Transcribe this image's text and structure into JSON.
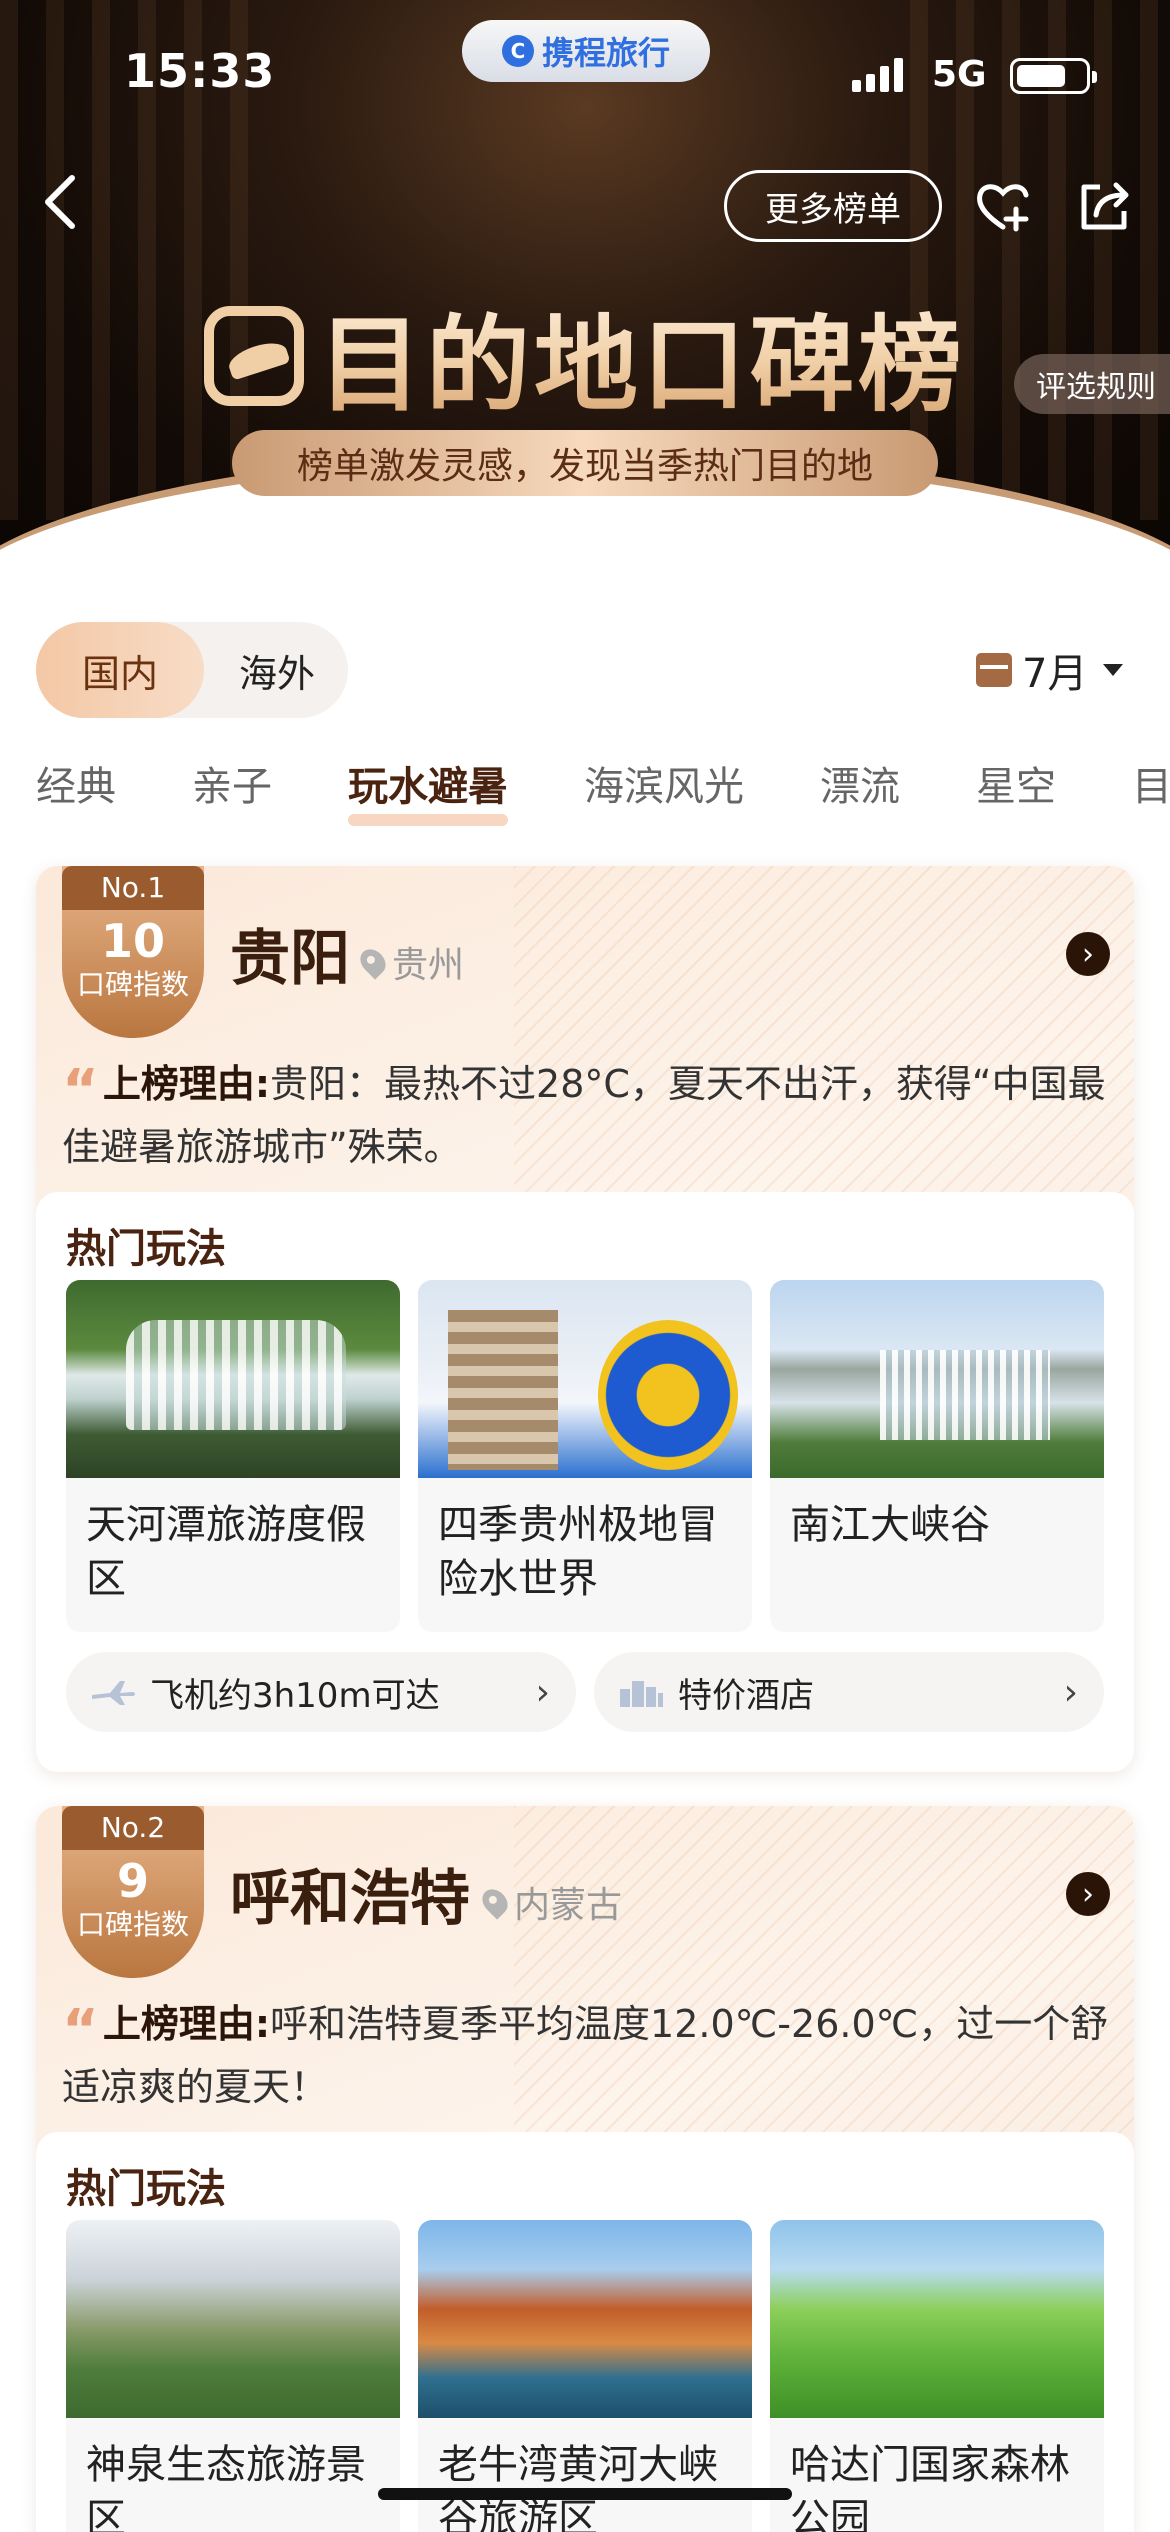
{
  "status_bar": {
    "time": "15:33",
    "app_name": "携程旅行",
    "network": "5G"
  },
  "header": {
    "more_lists_label": "更多榜单",
    "title": "目的地口碑榜",
    "subtitle": "榜单激发灵感，发现当季热门目的地",
    "rules_label": "评选规则"
  },
  "filters": {
    "region_active": "国内",
    "region_other": "海外",
    "month": "7月"
  },
  "categories": [
    "经典",
    "亲子",
    "玩水避暑",
    "海滨风光",
    "漂流",
    "星空",
    "目"
  ],
  "active_category_index": 2,
  "destinations": [
    {
      "rank_label": "No.1",
      "score": "10",
      "score_label": "口碑指数",
      "name": "贵阳",
      "province": "贵州",
      "reason_key": "上榜理由:",
      "reason": "贵阳：最热不过28°C，夏天不出汗，获得“中国最佳避暑旅游城市”殊荣。",
      "hot_title": "热门玩法",
      "spots": [
        "天河潭旅游度假区",
        "四季贵州极地冒险水世界",
        "南江大峡谷"
      ],
      "flight_label": "飞机约3h10m可达",
      "hotel_label": "特价酒店"
    },
    {
      "rank_label": "No.2",
      "score": "9",
      "score_label": "口碑指数",
      "name": "呼和浩特",
      "province": "内蒙古",
      "reason_key": "上榜理由:",
      "reason": "呼和浩特夏季平均温度12.0℃-26.0℃，过一个舒适凉爽的夏天！",
      "hot_title": "热门玩法",
      "spots": [
        "神泉生态旅游景区",
        "老牛湾黄河大峡谷旅游区",
        "哈达门国家森林公园"
      ]
    }
  ],
  "colors": {
    "accent": "#4a2410",
    "badge": "#b9763f",
    "brand": "#2f6fe0"
  }
}
